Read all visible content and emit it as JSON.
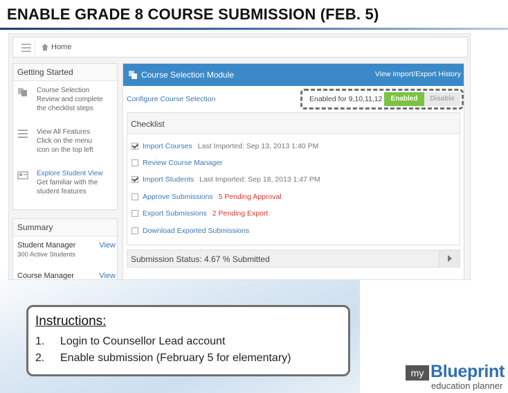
{
  "slide": {
    "title": "ENABLE GRADE 8 COURSE SUBMISSION (FEB. 5)"
  },
  "app": {
    "breadcrumb": "Home",
    "getting_started": {
      "heading": "Getting Started",
      "items": [
        {
          "icon": "copy-icon",
          "line1": "Course Selection",
          "line2": "Review and complete",
          "line3": "the checklist steps",
          "link": false
        },
        {
          "icon": "menu-icon",
          "line1": "View All Features",
          "line2": "Click on the menu",
          "line3": "icon on the top left",
          "link": false
        },
        {
          "icon": "id-card-icon",
          "line1": "Explore Student View",
          "line2": "Get familiar with the",
          "line3": "student features",
          "link": true
        }
      ]
    },
    "summary": {
      "heading": "Summary",
      "rows": [
        {
          "label": "Student Manager",
          "view": "View",
          "sub": "300 Active Students"
        },
        {
          "label": "Course Manager",
          "view": "View",
          "sub": ""
        }
      ]
    },
    "module": {
      "title": "Course Selection Module",
      "history_link": "View Import/Export History",
      "configure_link": "Configure Course Selection",
      "enabled_for": "Enabled for 9,10,11,12",
      "enabled_label": "Enabled",
      "disable_label": "Disable",
      "checklist_heading": "Checklist",
      "checklist": [
        {
          "name": "Import Courses",
          "meta": "Last Imported: Sep 13, 2013 1:40 PM",
          "warn": "",
          "checked": true
        },
        {
          "name": "Review Course Manager",
          "meta": "",
          "warn": "",
          "checked": false
        },
        {
          "name": "Import Students",
          "meta": "Last Imported: Sep 18, 2013 1:47 PM",
          "warn": "",
          "checked": true
        },
        {
          "name": "Approve Submissions",
          "meta": "",
          "warn": "5 Pending Approval",
          "checked": false
        },
        {
          "name": "Export Submissions",
          "meta": "",
          "warn": "2 Pending Export",
          "checked": false
        },
        {
          "name": "Download Exported Submissions",
          "meta": "",
          "warn": "",
          "checked": false
        }
      ],
      "status": "Submission Status: 4.67 % Submitted"
    }
  },
  "instructions": {
    "title": "Instructions:",
    "steps": [
      {
        "num": "1.",
        "text": "Login to Counsellor Lead account"
      },
      {
        "num": "2.",
        "text": "Enable submission (February 5 for elementary)"
      }
    ]
  },
  "logo": {
    "my": "my",
    "brand": "Blueprint",
    "sub": "education planner"
  },
  "colors": {
    "module_header": "#3b89c8",
    "enabled_green": "#7cc242",
    "link_blue": "#3a78b5",
    "warn_red": "#d9342b",
    "brand_blue": "#2e6fb5"
  }
}
